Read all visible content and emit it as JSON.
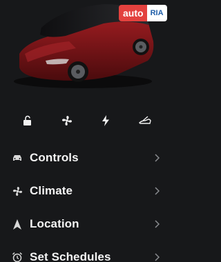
{
  "watermark": {
    "part1": "auto",
    "part2": "RIA"
  },
  "quick_controls": [
    {
      "name": "lock-button",
      "icon": "unlock-icon"
    },
    {
      "name": "climate-button",
      "icon": "fan-icon"
    },
    {
      "name": "charge-button",
      "icon": "bolt-icon"
    },
    {
      "name": "trunk-button",
      "icon": "trunk-icon"
    }
  ],
  "menu": {
    "items": [
      {
        "label": "Controls",
        "icon": "car-icon"
      },
      {
        "label": "Climate",
        "icon": "fan-icon"
      },
      {
        "label": "Location",
        "icon": "navigation-arrow-icon"
      },
      {
        "label": "Set Schedules",
        "icon": "alarm-clock-icon"
      }
    ]
  },
  "colors": {
    "background": "#17181a",
    "car_body": "#7a1518",
    "text": "#f2f2f2",
    "chevron": "#8a8c90"
  }
}
